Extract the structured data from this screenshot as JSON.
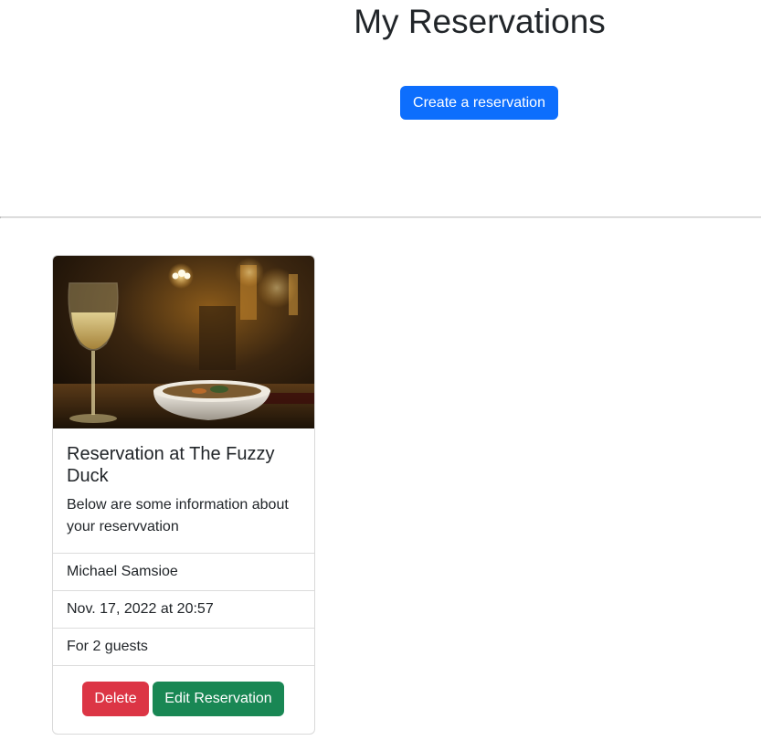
{
  "page": {
    "title": "My Reservations"
  },
  "actions": {
    "create_label": "Create a reservation"
  },
  "reservations": [
    {
      "image_alt": "Glass of white wine and a bowl of food in a dimly lit restaurant",
      "title": "Reservation at The Fuzzy Duck",
      "description": "Below are some information about your reservvation",
      "name": "Michael Samsioe",
      "datetime": "Nov. 17, 2022 at 20:57",
      "guests": "For 2 guests",
      "delete_label": "Delete",
      "edit_label": "Edit Reservation"
    }
  ],
  "colors": {
    "primary": "#0d6efd",
    "danger": "#dc3545",
    "success": "#198754",
    "text": "#212529",
    "border": "#dcdcdc"
  }
}
